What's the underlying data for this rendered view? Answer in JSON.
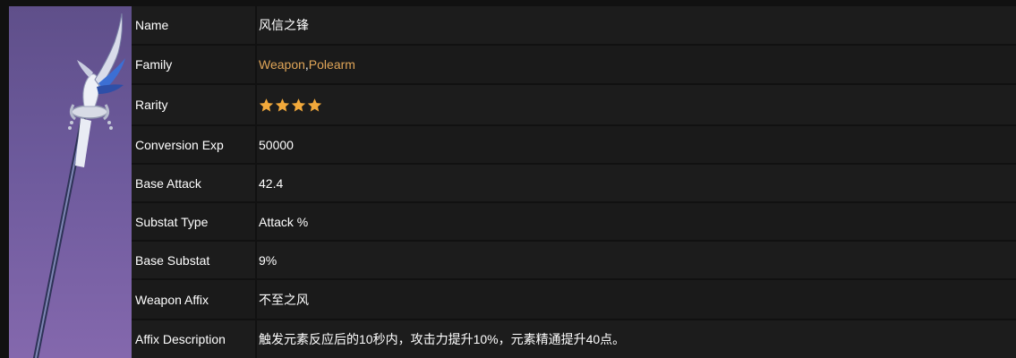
{
  "rows": [
    {
      "label": "Name",
      "value": "风信之锋"
    },
    {
      "label": "Family",
      "links": [
        "Weapon",
        "Polearm"
      ],
      "separator": ", "
    },
    {
      "label": "Rarity",
      "stars": 4,
      "star_color": "#f2a93b"
    },
    {
      "label": "Conversion Exp",
      "value": "50000"
    },
    {
      "label": "Base Attack",
      "value": "42.4"
    },
    {
      "label": "Substat Type",
      "value": "Attack %"
    },
    {
      "label": "Base Substat",
      "value": "9%"
    },
    {
      "label": "Weapon Affix",
      "value": "不至之风"
    },
    {
      "label": "Affix Description",
      "value": "触发元素反应后的10秒内，攻击力提升10%，元素精通提升40点。"
    }
  ],
  "colors": {
    "link": "#e0a558",
    "cell_bg": "#1c1c1c",
    "page_bg": "#111111",
    "portrait_top": "#5f4f8a",
    "portrait_bottom": "#8468ad"
  },
  "portrait": {
    "icon": "polearm-weapon-image"
  }
}
